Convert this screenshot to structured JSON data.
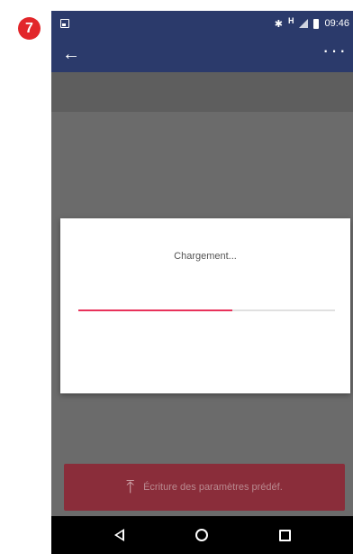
{
  "step_badge": "7",
  "status_bar": {
    "network": "H",
    "time": "09:46"
  },
  "icons": {
    "back": "arrow-left-icon",
    "more": "more-horizontal-icon",
    "upload": "upload-icon"
  },
  "dialog": {
    "message": "Chargement...",
    "progress": 0.6
  },
  "upload_button": {
    "label": "Écriture des paramètres prédéf."
  },
  "colors": {
    "app_bar": "#2b3a6b",
    "progress": "#e8325a",
    "badge": "#e2262a"
  }
}
